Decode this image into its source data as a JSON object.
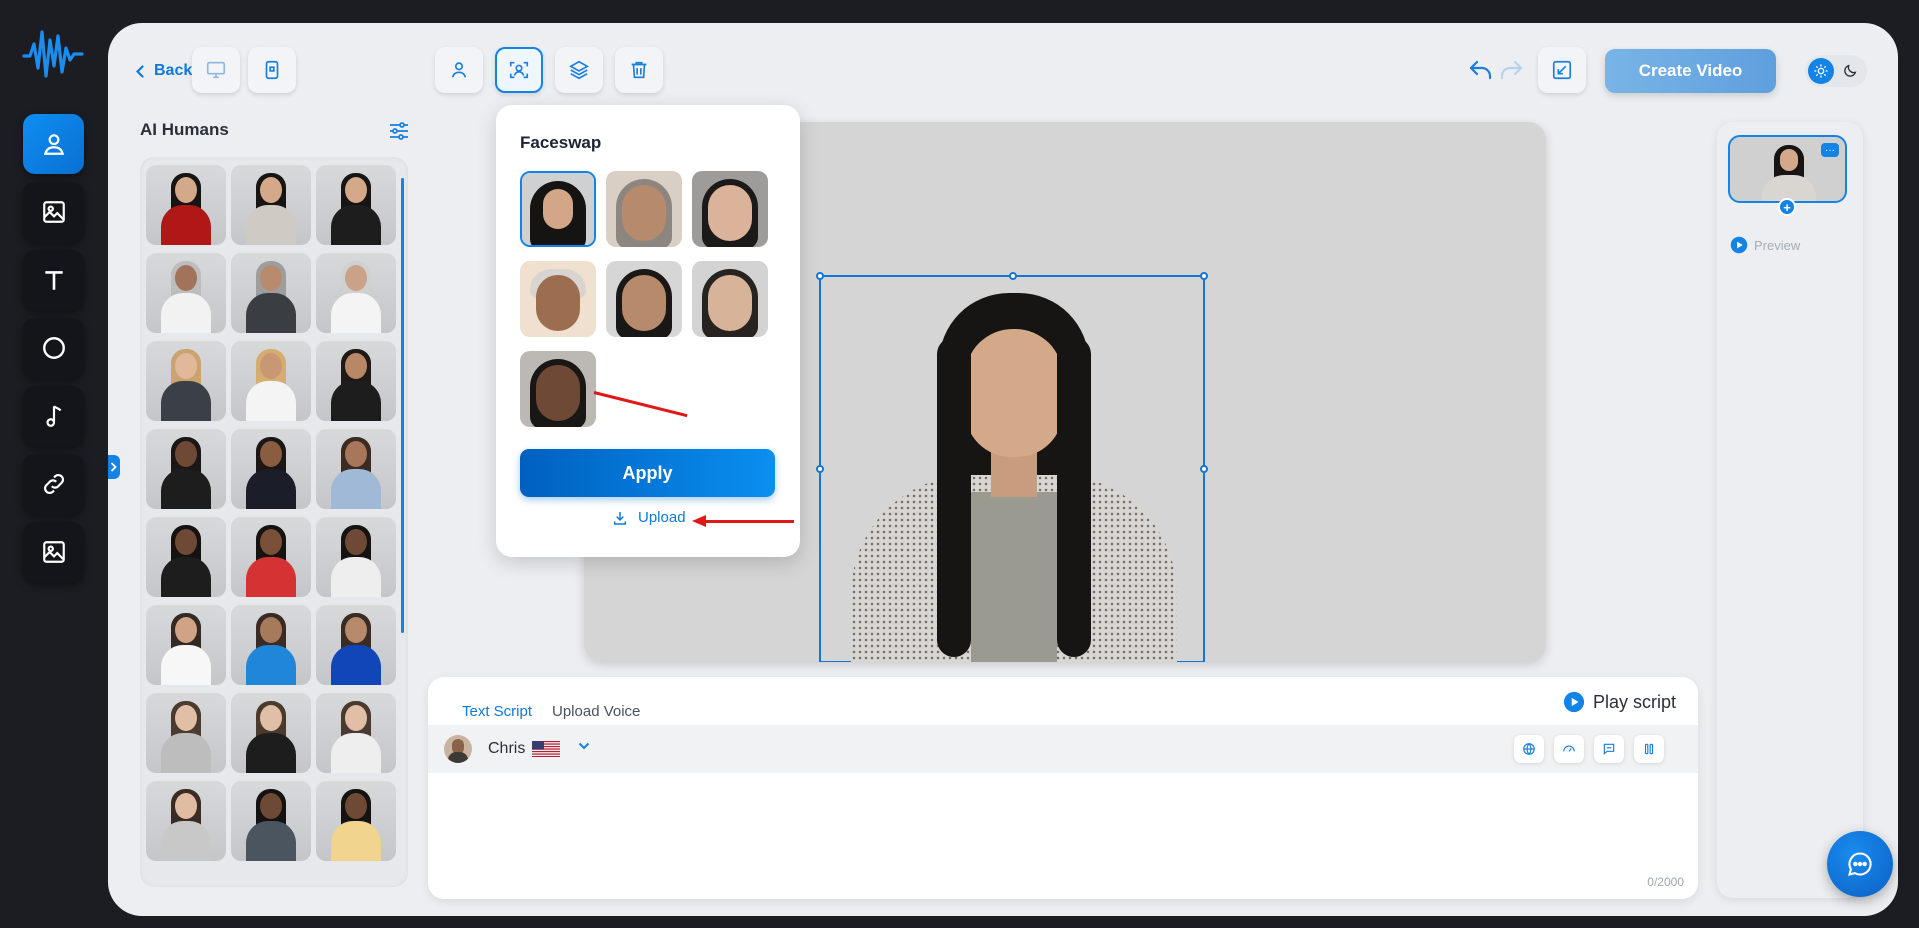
{
  "toolbar": {
    "back_label": "Back",
    "create_video_label": "Create Video"
  },
  "panel": {
    "title": "AI Humans"
  },
  "faceswap": {
    "title": "Faceswap",
    "apply_label": "Apply",
    "upload_label": "Upload"
  },
  "script": {
    "tabs": [
      {
        "label": "Text Script",
        "active": true
      },
      {
        "label": "Upload Voice",
        "active": false
      }
    ],
    "play_label": "Play script",
    "voice_name": "Chris",
    "voice_flag": "us-flag",
    "counter": "0/2000"
  },
  "scenes": {
    "preview_label": "Preview",
    "menu_glyph": "···",
    "add_glyph": "+"
  },
  "colors": {
    "accent": "#1384e6",
    "rail_bg": "#14151a",
    "app_bg": "#eceef1",
    "annotation_arrow": "#e01818"
  }
}
